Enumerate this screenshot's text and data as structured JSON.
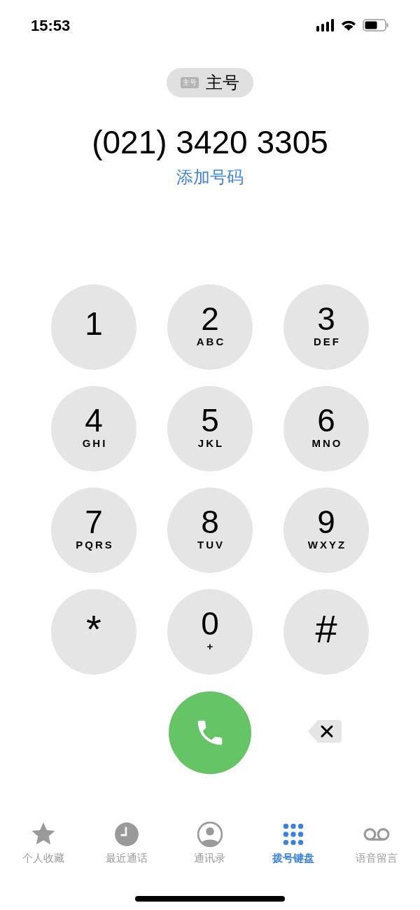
{
  "status_bar": {
    "time": "15:53"
  },
  "number_label": {
    "badge": "主号",
    "label": "主号"
  },
  "number": "(021) 3420 3305",
  "add_number": "添加号码",
  "keys": [
    {
      "digit": "1"
    },
    {
      "digit": "2",
      "letters": "ABC"
    },
    {
      "digit": "3",
      "letters": "DEF"
    },
    {
      "digit": "4",
      "letters": "GHI"
    },
    {
      "digit": "5",
      "letters": "JKL"
    },
    {
      "digit": "6",
      "letters": "MNO"
    },
    {
      "digit": "7",
      "letters": "PQRS"
    },
    {
      "digit": "8",
      "letters": "TUV"
    },
    {
      "digit": "9",
      "letters": "WXYZ"
    },
    {
      "digit": "*",
      "kind": "symbol"
    },
    {
      "digit": "0",
      "letters": "+"
    },
    {
      "digit": "#",
      "kind": "symbol"
    }
  ],
  "tabs": [
    {
      "label": "个人收藏",
      "kind": "favorites",
      "selected": false
    },
    {
      "label": "最近通话",
      "kind": "recents",
      "selected": false
    },
    {
      "label": "通讯录",
      "kind": "contacts",
      "selected": false
    },
    {
      "label": "拨号键盘",
      "kind": "keypad",
      "selected": true
    },
    {
      "label": "语音留言",
      "kind": "voicemail",
      "selected": false
    }
  ]
}
